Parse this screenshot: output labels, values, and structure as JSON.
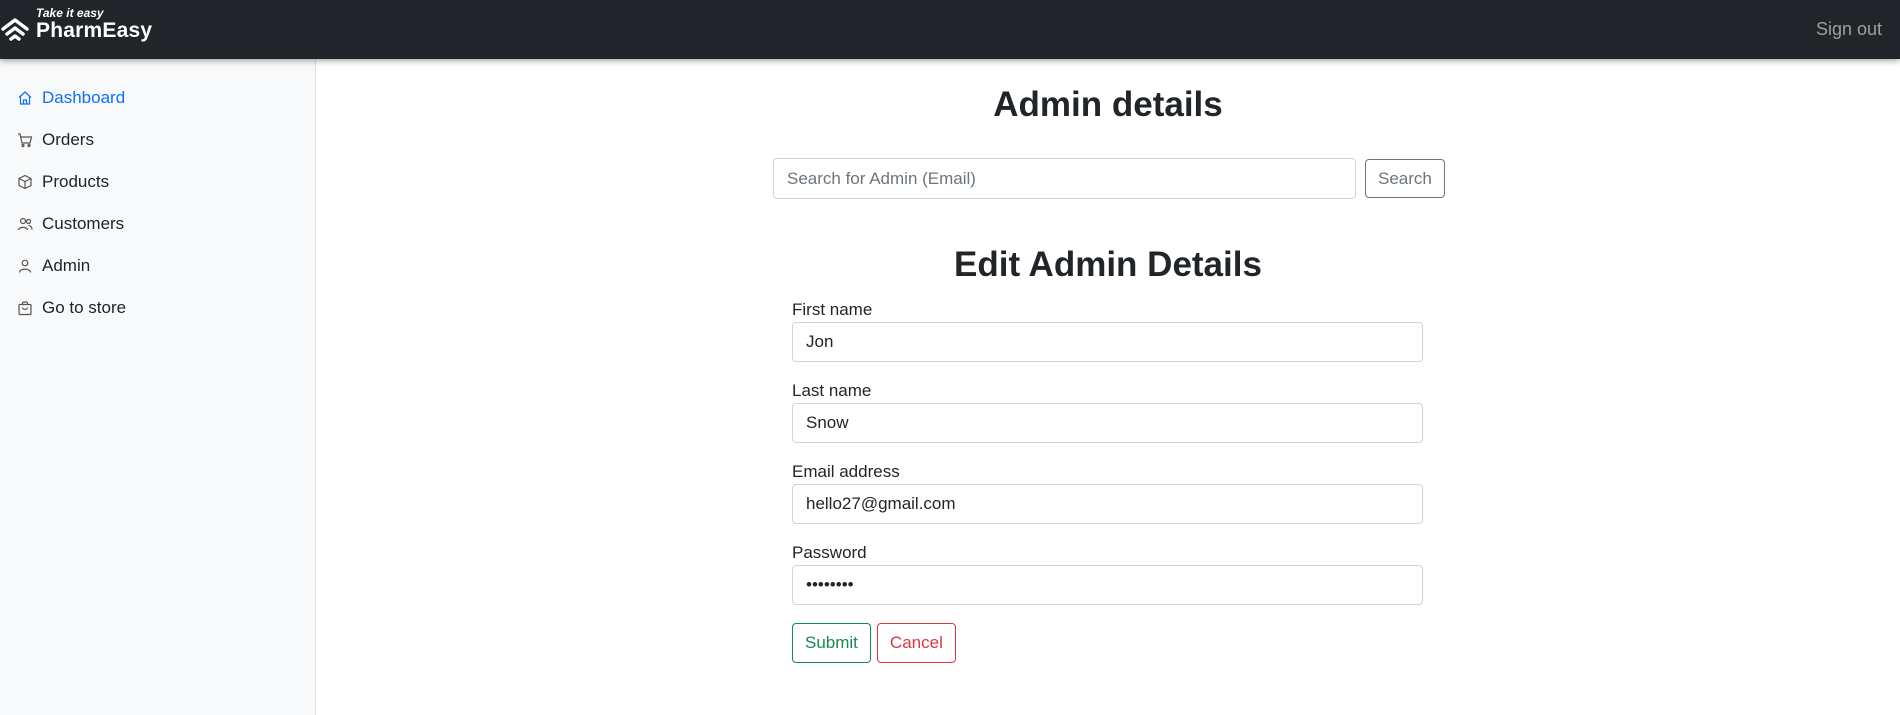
{
  "header": {
    "brand_tagline": "Take it easy",
    "brand_name": "PharmEasy",
    "brand_icon": "pharmeasy-logo",
    "signout_label": "Sign out"
  },
  "sidebar": {
    "items": [
      {
        "label": "Dashboard",
        "icon": "house-icon",
        "active": true
      },
      {
        "label": "Orders",
        "icon": "cart-icon",
        "active": false
      },
      {
        "label": "Products",
        "icon": "box-icon",
        "active": false
      },
      {
        "label": "Customers",
        "icon": "people-icon",
        "active": false
      },
      {
        "label": "Admin",
        "icon": "person-icon",
        "active": false
      },
      {
        "label": "Go to store",
        "icon": "bag-icon",
        "active": false
      }
    ]
  },
  "main": {
    "title": "Admin details",
    "search": {
      "placeholder": "Search for Admin (Email)",
      "value": "",
      "button_label": "Search"
    },
    "form": {
      "title": "Edit Admin Details",
      "first_name": {
        "label": "First name",
        "value": "Jon"
      },
      "last_name": {
        "label": "Last name",
        "value": "Snow"
      },
      "email": {
        "label": "Email address",
        "value": "hello27@gmail.com"
      },
      "password": {
        "label": "Password",
        "value": "••••••••"
      },
      "submit_label": "Submit",
      "cancel_label": "Cancel"
    }
  },
  "colors": {
    "topbar": "#212529",
    "sidebar": "#f8f9fa",
    "active_link": "#0d6efd",
    "submit": "#198754",
    "cancel": "#dc3545",
    "secondary": "#6c757d"
  }
}
